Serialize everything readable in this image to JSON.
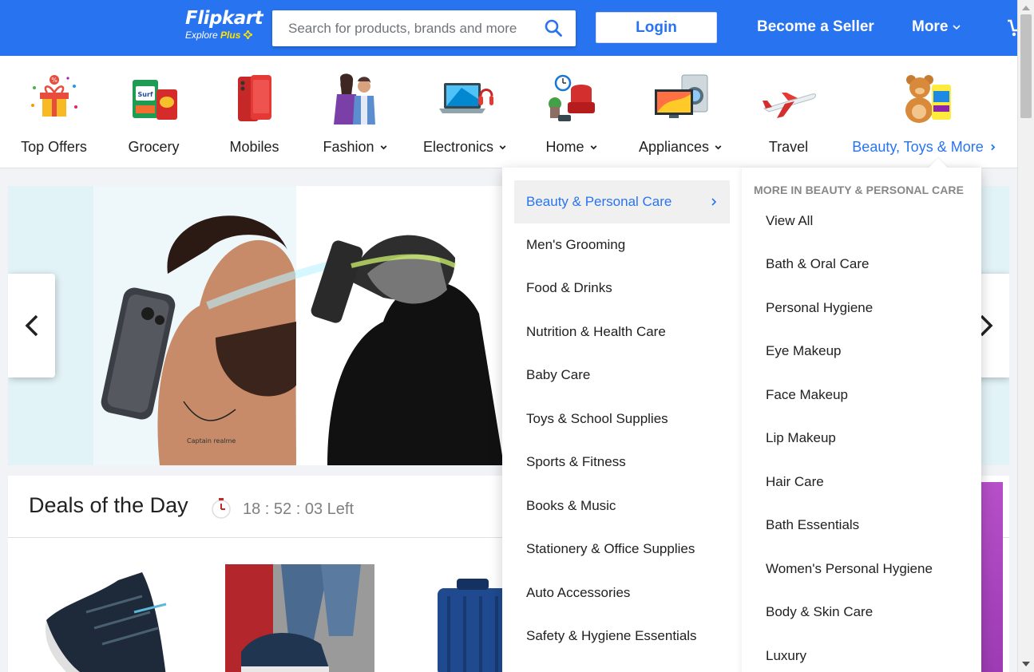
{
  "header": {
    "logo_text": "Flipkart",
    "logo_sub": "Explore",
    "logo_plus": "Plus",
    "search_placeholder": "Search for products, brands and more",
    "login_label": "Login",
    "seller_label": "Become a Seller",
    "more_label": "More"
  },
  "categories": [
    {
      "label": "Top Offers"
    },
    {
      "label": "Grocery"
    },
    {
      "label": "Mobiles"
    },
    {
      "label": "Fashion"
    },
    {
      "label": "Electronics"
    },
    {
      "label": "Home"
    },
    {
      "label": "Appliances"
    },
    {
      "label": "Travel"
    },
    {
      "label": "Beauty, Toys & More"
    }
  ],
  "banner": {
    "signature_caption": "Captain realme"
  },
  "deals": {
    "title": "Deals of the Day",
    "timer": "18 : 52 : 03 Left"
  },
  "dropdown": {
    "left_items": [
      {
        "label": "Beauty & Personal Care"
      },
      {
        "label": "Men's Grooming"
      },
      {
        "label": "Food & Drinks"
      },
      {
        "label": "Nutrition & Health Care"
      },
      {
        "label": "Baby Care"
      },
      {
        "label": "Toys & School Supplies"
      },
      {
        "label": "Sports & Fitness"
      },
      {
        "label": "Books & Music"
      },
      {
        "label": "Stationery & Office Supplies"
      },
      {
        "label": "Auto Accessories"
      },
      {
        "label": "Safety & Hygiene Essentials"
      }
    ],
    "right_heading": "MORE IN BEAUTY & PERSONAL CARE",
    "right_items": [
      {
        "label": "View All"
      },
      {
        "label": "Bath & Oral Care"
      },
      {
        "label": "Personal Hygiene"
      },
      {
        "label": "Eye Makeup"
      },
      {
        "label": "Face Makeup"
      },
      {
        "label": "Lip Makeup"
      },
      {
        "label": "Hair Care"
      },
      {
        "label": "Bath Essentials"
      },
      {
        "label": "Women's Personal Hygiene"
      },
      {
        "label": "Body & Skin Care"
      },
      {
        "label": "Luxury"
      }
    ]
  },
  "colors": {
    "brand": "#2874f0",
    "accent_yellow": "#ffe500"
  }
}
